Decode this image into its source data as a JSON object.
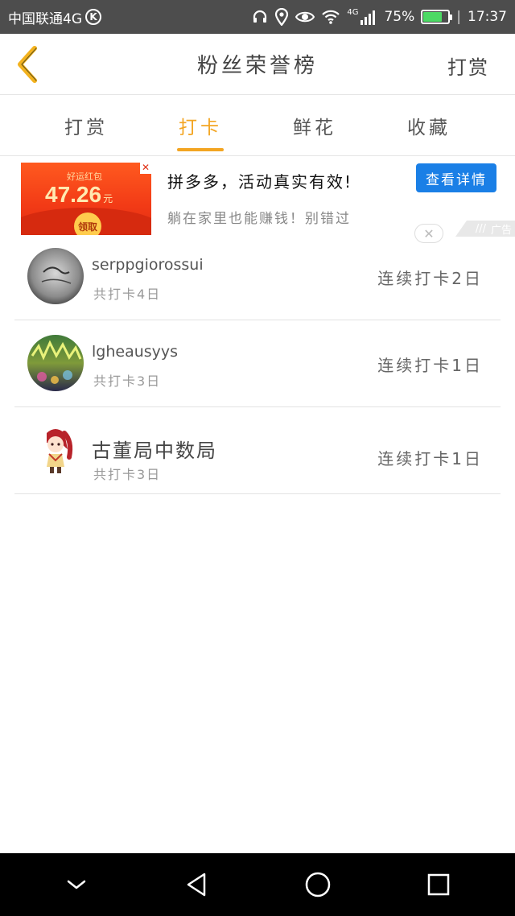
{
  "status_bar": {
    "carrier": "中国联通4G",
    "carrier_badge": "K",
    "network": "4G",
    "battery": "75%",
    "battery_level": 0.75,
    "time": "17:37",
    "icons": [
      "headphones-icon",
      "location-icon",
      "eye-icon",
      "wifi-icon",
      "signal-icon",
      "battery-icon"
    ]
  },
  "header": {
    "title": "粉丝荣誉榜",
    "back_icon": "chevron-left-icon",
    "action_label": "打赏"
  },
  "tabs": [
    {
      "label": "打赏",
      "active": false
    },
    {
      "label": "打卡",
      "active": true
    },
    {
      "label": "鲜花",
      "active": false
    },
    {
      "label": "收藏",
      "active": false
    }
  ],
  "ad": {
    "image": {
      "caption": "好运红包",
      "amount": "47.26",
      "unit": "元",
      "button": "领取"
    },
    "headline": "拼多多，活动真实有效!",
    "subtext": "躺在家里也能赚钱！别错过",
    "cta_label": "查看详情",
    "badge_label": "广告",
    "close_icon": "close-icon"
  },
  "fans": [
    {
      "name": "serppgiorossui",
      "total": "共打卡4日",
      "streak": "连续打卡2日"
    },
    {
      "name": "lgheausyys",
      "total": "共打卡3日",
      "streak": "连续打卡1日"
    },
    {
      "name": "古董局中数局",
      "total": "共打卡3日",
      "streak": "连续打卡1日"
    }
  ],
  "colors": {
    "accent": "#f3a522",
    "status_bar": "#4d4d4d",
    "cta_blue": "#1a7fe6",
    "battery_green": "#4cd964",
    "nav_bar": "#000000"
  },
  "nav_bar": {
    "icons": [
      "collapse-icon",
      "back-triangle-icon",
      "home-circle-icon",
      "recents-square-icon"
    ]
  }
}
